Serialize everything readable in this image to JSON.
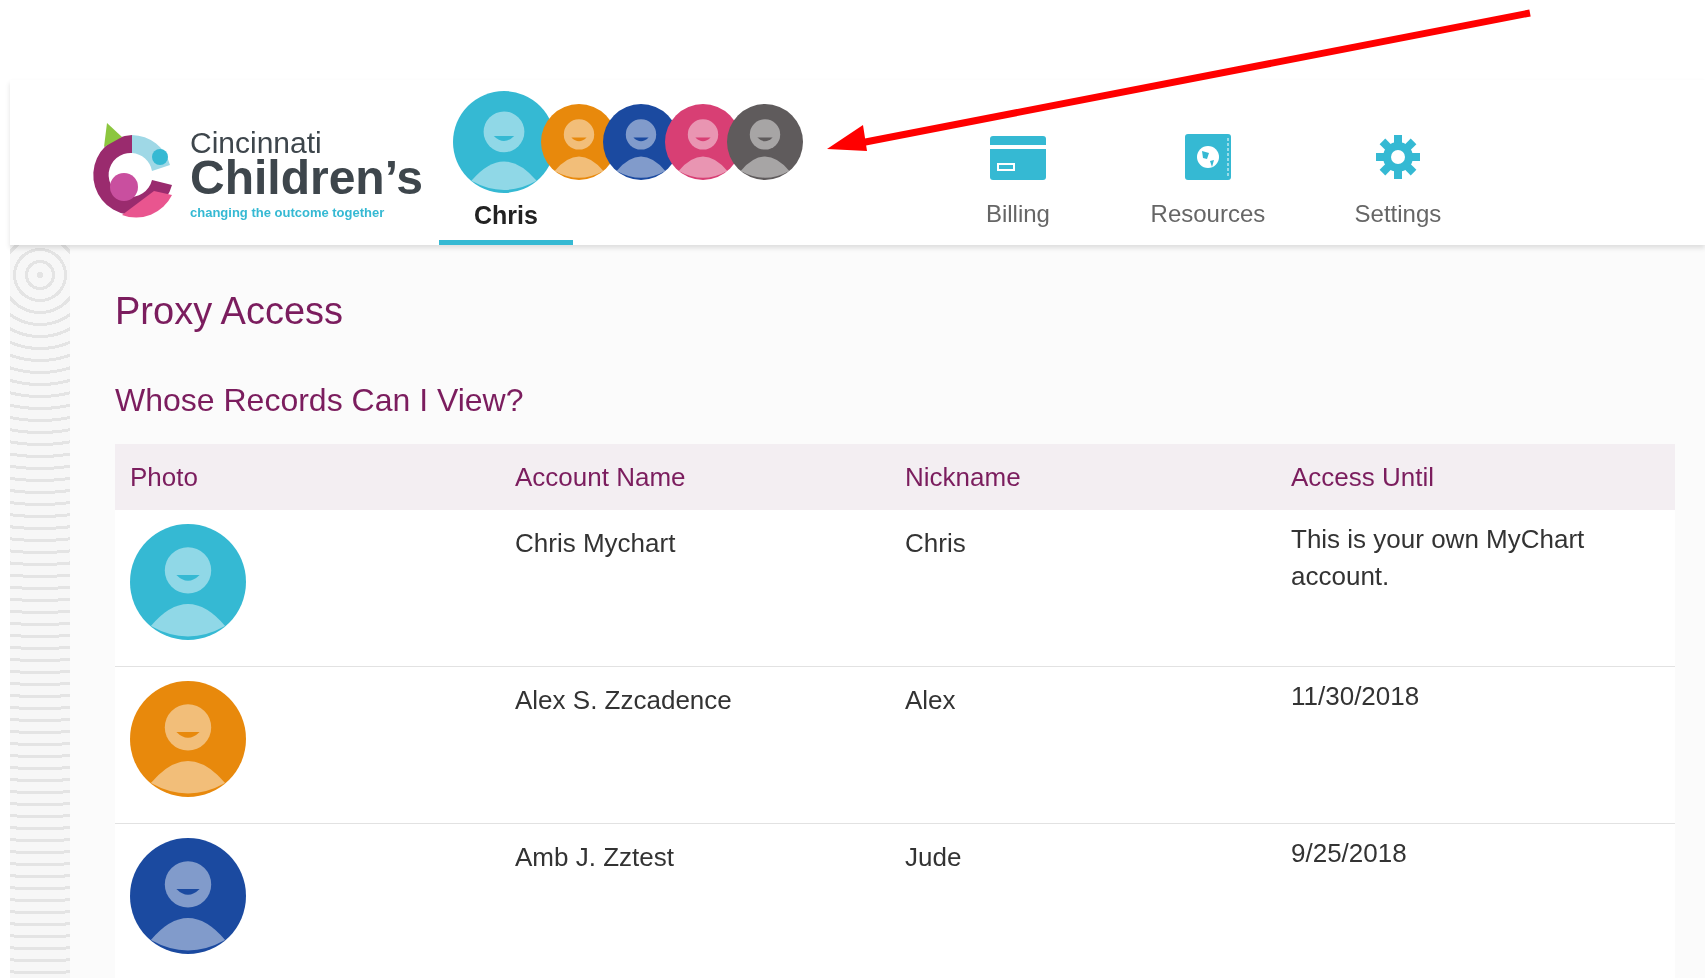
{
  "header": {
    "logo": {
      "line_1": "Cincinnati",
      "line_2": "Children’s",
      "tagline": "changing the outcome together"
    },
    "profiles": [
      {
        "color": "#35b9d3"
      },
      {
        "color": "#e8890c"
      },
      {
        "color": "#1b4aa0"
      },
      {
        "color": "#d83f74"
      },
      {
        "color": "#5f5b5c"
      }
    ],
    "tabs": [
      {
        "kind": "profile",
        "label": "Chris",
        "selected": true
      },
      {
        "kind": "billing",
        "label": "Billing",
        "selected": false
      },
      {
        "kind": "resources",
        "label": "Resources",
        "selected": false
      },
      {
        "kind": "settings",
        "label": "Settings",
        "selected": false
      }
    ]
  },
  "page": {
    "title": "Proxy Access",
    "subtitle": "Whose Records Can I View?"
  },
  "table": {
    "columns": [
      "Photo",
      "Account Name",
      "Nickname",
      "Access Until"
    ],
    "rows": [
      {
        "color": "#35b9d3",
        "account_name": "Chris Mychart",
        "nickname": "Chris",
        "access_until": "This is your own MyChart account."
      },
      {
        "color": "#e8890c",
        "account_name": "Alex S. Zzcadence",
        "nickname": "Alex",
        "access_until": "11/30/2018"
      },
      {
        "color": "#1b4aa0",
        "account_name": "Amb J. Zztest",
        "nickname": "Jude",
        "access_until": "9/25/2018"
      }
    ]
  }
}
